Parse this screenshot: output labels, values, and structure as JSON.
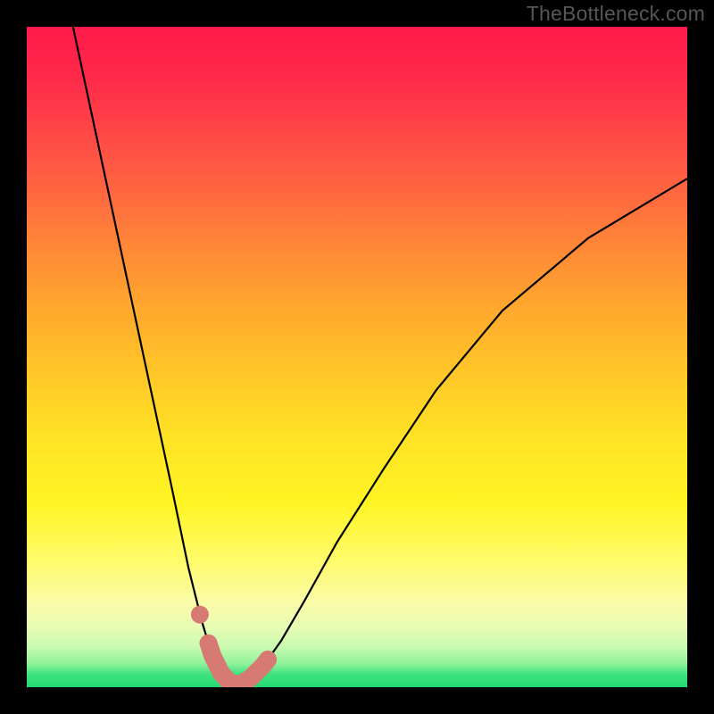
{
  "watermark": "TheBottleneck.com",
  "chart_data": {
    "type": "line",
    "title": "",
    "xlabel": "",
    "ylabel": "",
    "xlim": [
      0,
      100
    ],
    "ylim": [
      0,
      100
    ],
    "grid": false,
    "legend": false,
    "series": [
      {
        "name": "bottleneck-curve",
        "color": "#000000",
        "x": [
          7,
          10,
          13,
          16,
          19,
          22,
          24.5,
          26.5,
          28,
          29.5,
          31,
          32.5,
          34,
          36,
          38.5,
          42,
          47,
          54,
          62,
          72,
          85,
          100
        ],
        "y": [
          100,
          86,
          72,
          58,
          44,
          30,
          18,
          10,
          5,
          2,
          0.5,
          0.5,
          1.5,
          3.5,
          7,
          13,
          22,
          33,
          45,
          57,
          68,
          77
        ]
      }
    ],
    "markers": [
      {
        "name": "highlight-valley-band",
        "color": "#d77a74",
        "shape": "worm",
        "x_from": 27.5,
        "x_to": 36.5,
        "thickness": 20
      },
      {
        "name": "highlight-dot",
        "color": "#d77a74",
        "shape": "circle",
        "x": 26.2,
        "y": 11,
        "r": 10
      }
    ],
    "background_gradient": {
      "direction": "top-to-bottom",
      "stops": [
        {
          "pos": 0,
          "color": "#ff1a4a"
        },
        {
          "pos": 50,
          "color": "#ffc528"
        },
        {
          "pos": 82,
          "color": "#fffb63"
        },
        {
          "pos": 100,
          "color": "#22da72"
        }
      ]
    }
  }
}
